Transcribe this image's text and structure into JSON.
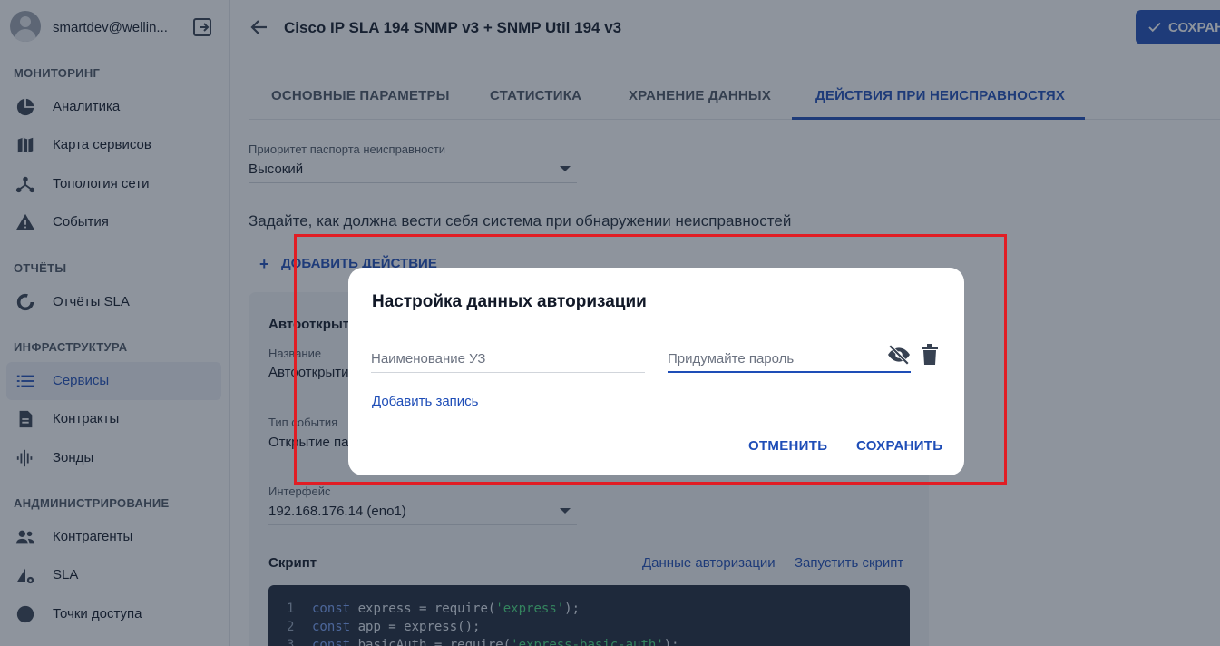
{
  "sidebar": {
    "user": {
      "name": "smartdev@wellin..."
    },
    "sections": [
      {
        "label": "МОНИТОРИНГ",
        "items": [
          {
            "label": "Аналитика",
            "icon": "pie-chart-icon"
          },
          {
            "label": "Карта сервисов",
            "icon": "map-icon"
          },
          {
            "label": "Топология сети",
            "icon": "topology-icon"
          },
          {
            "label": "События",
            "icon": "warning-icon"
          }
        ]
      },
      {
        "label": "ОТЧЁТЫ",
        "items": [
          {
            "label": "Отчёты SLA",
            "icon": "donut-icon"
          }
        ]
      },
      {
        "label": "ИНФРАСТРУКТУРА",
        "items": [
          {
            "label": "Сервисы",
            "icon": "list-icon",
            "active": true
          },
          {
            "label": "Контракты",
            "icon": "document-icon"
          },
          {
            "label": "Зонды",
            "icon": "probe-icon"
          }
        ]
      },
      {
        "label": "АНДМИНИСТРИРОВАНИЕ",
        "items": [
          {
            "label": "Контрагенты",
            "icon": "people-icon"
          },
          {
            "label": "SLA",
            "icon": "sla-icon"
          },
          {
            "label": "Точки доступа",
            "icon": "circle-icon"
          }
        ]
      }
    ]
  },
  "header": {
    "title": "Cisco IP SLA 194 SNMP v3 + SNMP Util 194 v3",
    "save_label": "СОХРАН"
  },
  "tabs": [
    {
      "label": "ОСНОВНЫЕ ПАРАМЕТРЫ",
      "active": false
    },
    {
      "label": "СТАТИСТИКА",
      "active": false
    },
    {
      "label": "ХРАНЕНИЕ ДАННЫХ",
      "active": false
    },
    {
      "label": "ДЕЙСТВИЯ ПРИ НЕИСПРАВНОСТЯХ",
      "active": true
    }
  ],
  "form": {
    "priority_label": "Приоритет паспорта неисправности",
    "priority_value": "Высокий",
    "hint": "Задайте, как должна вести себя система при обнаружении неисправностей",
    "add_action": "ДОБАВИТЬ ДЕЙСТВИЕ",
    "card": {
      "title": "Автооткрыт",
      "name_label": "Название",
      "name_value": "Автооткрыти",
      "event_type_label": "Тип события",
      "event_type_value": "Открытие па",
      "interface_label": "Интерфейс",
      "interface_value": "192.168.176.14 (eno1)",
      "script_label": "Скрипт",
      "auth_link": "Данные авторизации",
      "run_link": "Запустить скрипт",
      "code_lines": [
        {
          "n": "1",
          "kw": "const",
          "rest": " express = require(",
          "str": "'express'",
          "end": ");"
        },
        {
          "n": "2",
          "kw": "const",
          "rest": " app = express();",
          "str": "",
          "end": ""
        },
        {
          "n": "3",
          "kw": "const",
          "rest": " basicAuth = require(",
          "str": "'express-basic-auth'",
          "end": ");"
        }
      ]
    }
  },
  "dialog": {
    "title": "Настройка данных авторизации",
    "login_placeholder": "Наименование УЗ",
    "password_placeholder": "Придумайте пароль",
    "add_record": "Добавить запись",
    "cancel": "ОТМЕНИТЬ",
    "save": "СОХРАНИТЬ"
  },
  "colors": {
    "accent": "#1e4db7",
    "highlight": "#e11d24"
  }
}
